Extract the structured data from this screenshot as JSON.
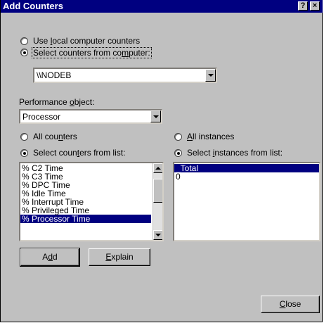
{
  "window": {
    "title": "Add Counters"
  },
  "titlebar": {
    "help_glyph": "?",
    "close_glyph": "×"
  },
  "computer": {
    "use_local_label": "Use local computer counters",
    "select_from_label": "Select counters from computer:",
    "selected_option": "select_from",
    "computer_value": "\\\\NODEB"
  },
  "performance_object": {
    "label": "Performance object:",
    "value": "Processor"
  },
  "counters": {
    "all_label": "All counters",
    "select_label": "Select counters from list:",
    "selected_option": "select_from_list",
    "items": [
      "% C2 Time",
      "% C3 Time",
      "% DPC Time",
      "% Idle Time",
      "% Interrupt Time",
      "% Privileged Time",
      "% Processor Time"
    ],
    "selected_item": "% Processor Time"
  },
  "instances": {
    "all_label": "All instances",
    "select_label": "Select instances from list:",
    "selected_option": "select_from_list",
    "items": [
      "_Total",
      "0"
    ],
    "selected_item": "_Total"
  },
  "buttons": {
    "add": "Add",
    "explain": "Explain",
    "close": "Close"
  }
}
